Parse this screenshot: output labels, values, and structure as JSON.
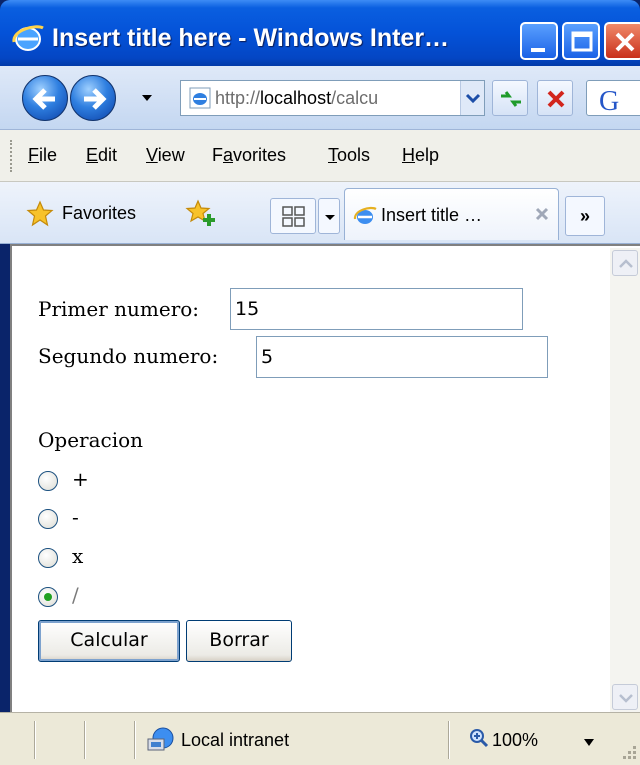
{
  "window": {
    "title": "Insert title here - Windows Inter…"
  },
  "address_bar": {
    "url_prefix": "http://",
    "url_host": "localhost",
    "url_rest": "/calcu"
  },
  "menu": {
    "items": [
      {
        "label": "File",
        "accel": "F",
        "rest": "ile"
      },
      {
        "label": "Edit",
        "accel": "E",
        "rest": "dit"
      },
      {
        "label": "View",
        "accel": "V",
        "rest": "iew"
      },
      {
        "label": "Favorites",
        "accel": "a",
        "pre": "F",
        "rest": "vorites"
      },
      {
        "label": "Tools",
        "accel": "T",
        "rest": "ools"
      },
      {
        "label": "Help",
        "accel": "H",
        "rest": "elp"
      }
    ]
  },
  "favorites_bar": {
    "favorites_label": "Favorites",
    "tab_title": "Insert title …",
    "more_label": "»"
  },
  "form": {
    "first_label": "Primer numero:",
    "first_value": "15",
    "second_label": "Segundo numero:",
    "second_value": "5",
    "operation_label": "Operacion",
    "operations": [
      {
        "symbol": "+",
        "checked": false
      },
      {
        "symbol": "-",
        "checked": false
      },
      {
        "symbol": "x",
        "checked": false
      },
      {
        "symbol": "/",
        "checked": true
      }
    ],
    "calculate_label": "Calcular",
    "clear_label": "Borrar"
  },
  "status_bar": {
    "zone": "Local intranet",
    "zoom": "100%"
  },
  "colors": {
    "titlebar": "#0452d8",
    "checked_radio": "#21a121"
  }
}
